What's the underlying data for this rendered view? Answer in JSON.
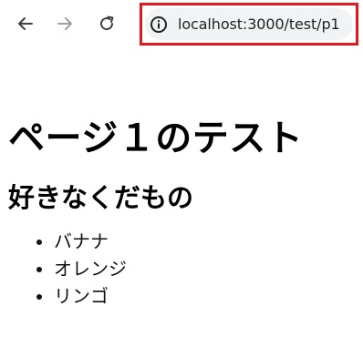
{
  "browser": {
    "url": "localhost:3000/test/p1",
    "highlight_color": "#e0191f",
    "icons": {
      "back": "back-arrow-icon",
      "forward": "forward-arrow-icon",
      "reload": "reload-icon",
      "info": "info-icon"
    }
  },
  "page": {
    "title": "ページ１のテスト",
    "subtitle": "好きなくだもの",
    "items": [
      "バナナ",
      "オレンジ",
      "リンゴ"
    ]
  }
}
